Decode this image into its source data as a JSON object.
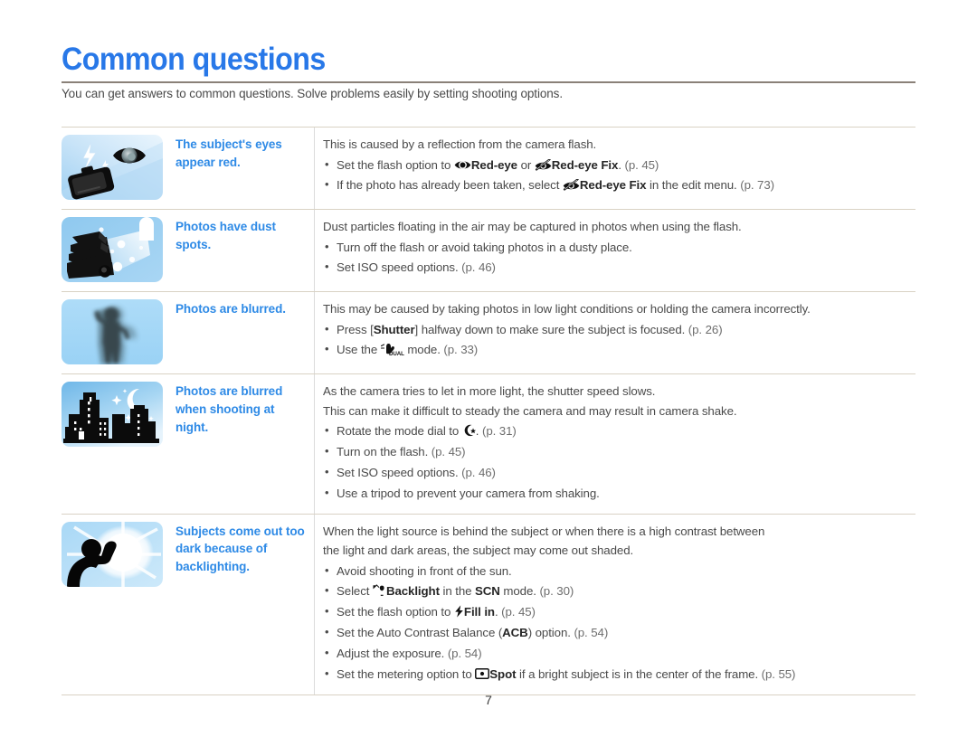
{
  "document": {
    "title": "Common questions",
    "intro": "You can get answers to common questions. Solve problems easily by setting shooting options.",
    "page_number": "7",
    "accent_color": "#2878e8",
    "question_color": "#2e8ae6",
    "rule_color": "#8a8178",
    "row_border_color": "#d9d2c4"
  },
  "rows": [
    {
      "icon_name": "red-eye-camera-icon",
      "question": "The subject's eyes appear red.",
      "lead": "This is caused by a reflection from the camera flash.",
      "bullets": [
        {
          "pre": "Set the flash option to ",
          "icon1": "eye-icon",
          "bold1": "Red-eye",
          "mid": " or ",
          "icon2": "eye-fix-icon",
          "bold2": "Red-eye Fix",
          "post": ". ",
          "page_ref": "(p. 45)"
        },
        {
          "pre": "If the photo has already been taken, select ",
          "icon1": "eye-fix-icon",
          "bold1": "Red-eye Fix",
          "mid": " in the edit menu. ",
          "page_ref": "(p. 73)"
        }
      ]
    },
    {
      "icon_name": "dust-spots-icon",
      "question": "Photos have dust spots.",
      "lead": "Dust particles floating in the air may be captured in photos when using the flash.",
      "bullets": [
        {
          "pre": "Turn off the flash or avoid taking photos in a dusty place.",
          "page_ref": ""
        },
        {
          "pre": "Set ISO speed options. ",
          "page_ref": "(p. 46)"
        }
      ]
    },
    {
      "icon_name": "blurred-person-icon",
      "question": "Photos are blurred.",
      "lead": "This may be caused by taking photos in low light conditions or holding the camera incorrectly.",
      "bullets": [
        {
          "pre": "Press [",
          "bold1": "Shutter",
          "mid": "] halfway down to make sure the subject is focused. ",
          "page_ref": "(p. 26)"
        },
        {
          "pre": "Use the ",
          "icon1": "dual-is-icon",
          "mid": " mode. ",
          "page_ref": "(p. 33)"
        }
      ]
    },
    {
      "icon_name": "night-cityscape-icon",
      "question": "Photos are blurred when shooting at night.",
      "lead": "As the camera tries to let in more light, the shutter speed slows.",
      "lead2": "This can make it difficult to steady the camera and may result in camera shake.",
      "bullets": [
        {
          "pre": "Rotate the mode dial to ",
          "icon1": "night-mode-icon",
          "mid": ". ",
          "page_ref": "(p. 31)"
        },
        {
          "pre": "Turn on the flash. ",
          "page_ref": "(p. 45)"
        },
        {
          "pre": "Set ISO speed options. ",
          "page_ref": "(p. 46)"
        },
        {
          "pre": "Use a tripod to prevent your camera from shaking.",
          "page_ref": ""
        }
      ]
    },
    {
      "icon_name": "backlighting-icon",
      "question": "Subjects come out too dark because of backlighting.",
      "lead": "When the light source is behind the subject or when there is a high contrast between",
      "lead2": "the light and dark areas, the subject may come out shaded.",
      "bullets": [
        {
          "pre": "Avoid shooting in front of the sun.",
          "page_ref": ""
        },
        {
          "pre": "Select ",
          "icon1": "backlight-scene-icon",
          "bold1": "Backlight",
          "mid": " in the ",
          "bold2": "SCN",
          "post": " mode. ",
          "page_ref": "(p. 30)"
        },
        {
          "pre": "Set the flash option to ",
          "icon1": "fill-in-flash-icon",
          "bold1": "Fill in",
          "mid": ". ",
          "page_ref": "(p. 45)"
        },
        {
          "pre": "Set the Auto Contrast Balance (",
          "bold1": "ACB",
          "mid": ") option. ",
          "page_ref": "(p. 54)"
        },
        {
          "pre": "Adjust the exposure. ",
          "page_ref": "(p. 54)"
        },
        {
          "pre": "Set the metering option to ",
          "icon1": "spot-metering-icon",
          "bold1": "Spot",
          "mid": " if a bright subject is in the center of the frame. ",
          "page_ref": "(p. 55)"
        }
      ]
    }
  ]
}
